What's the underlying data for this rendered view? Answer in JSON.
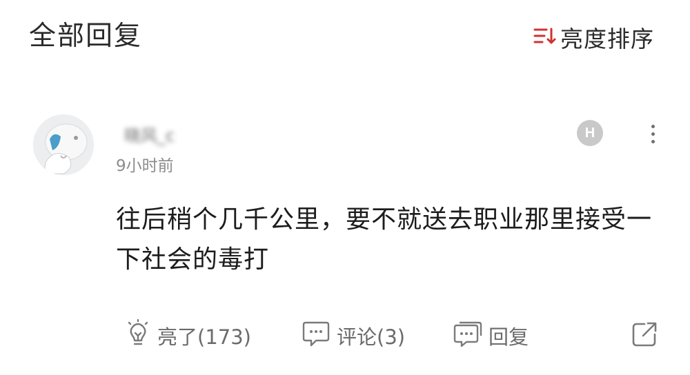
{
  "header": {
    "title": "全部回复",
    "sort_label": "亮度排序",
    "sort_icon_color": "#d23030"
  },
  "comment": {
    "username": "晓风_c",
    "time": "9小时前",
    "badge": "H",
    "text": "往后稍个几千公里，要不就送去职业那里接受一下社会的毒打"
  },
  "actions": {
    "like_label": "亮了(173)",
    "comment_label": "评论(3)",
    "reply_label": "回复",
    "share_icon": "share-icon"
  }
}
